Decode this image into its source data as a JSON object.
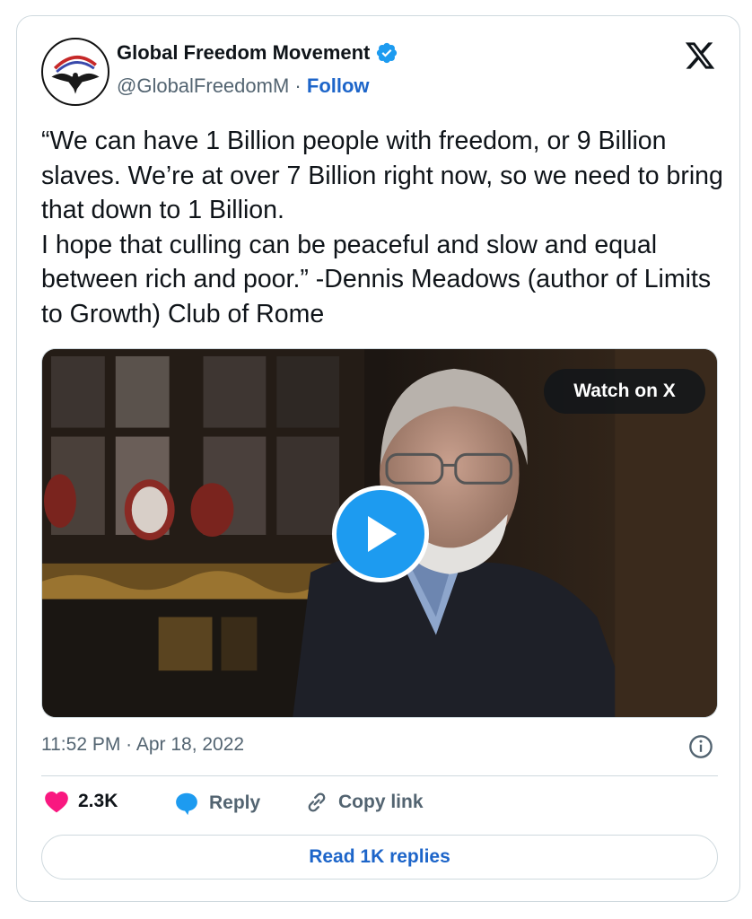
{
  "author": {
    "name": "Global Freedom Movement",
    "handle": "@GlobalFreedomM",
    "separator": "·",
    "follow_label": "Follow",
    "verified": true
  },
  "tweet": {
    "paragraphs": [
      "“We can have 1 Billion people with freedom, or 9 Billion slaves. We’re at over 7 Billion right now, so we need to bring that down to 1 Billion.",
      "I hope that culling can be peaceful and slow and equal between rich and poor.” -Dennis Meadows (author of Limits to Growth) Club of Rome"
    ]
  },
  "media": {
    "watch_label": "Watch on X"
  },
  "meta": {
    "timestamp": "11:52 PM · Apr 18, 2022"
  },
  "actions": {
    "like_count": "2.3K",
    "reply_label": "Reply",
    "copy_link_label": "Copy link",
    "read_replies_label": "Read 1K replies"
  },
  "colors": {
    "link_blue": "#1d65c9",
    "verified_blue": "#1d9bf0",
    "like_pink": "#f91880",
    "muted_text": "#536471"
  }
}
